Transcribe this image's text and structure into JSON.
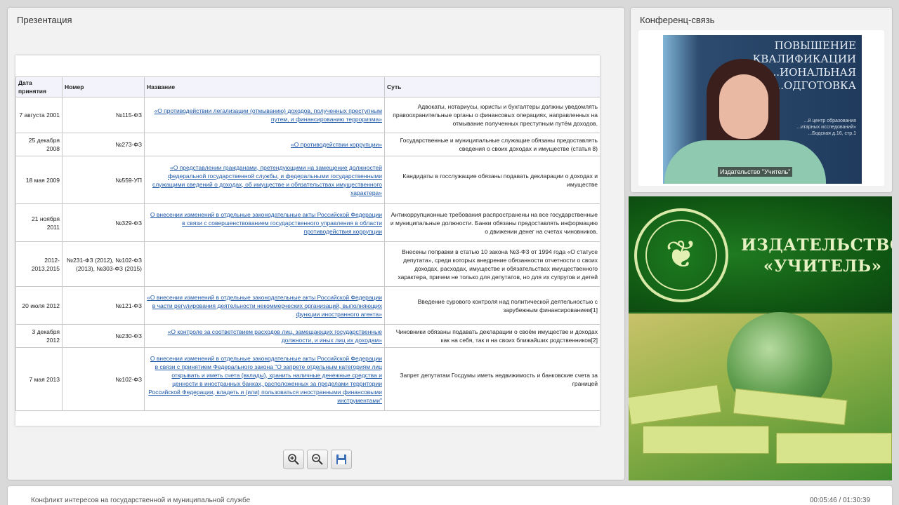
{
  "presentation": {
    "title": "Презентация",
    "table": {
      "headers": [
        "Дата принятия",
        "Номер",
        "Название",
        "Суть"
      ],
      "rows": [
        {
          "date": "7 августа 2001",
          "number": "№115-ФЗ",
          "name": "«О противодействии легализации (отмыванию) доходов, полученных преступным путем, и финансированию терроризма»",
          "essence": "Адвокаты, нотариусы, юристы и бухгалтеры должны уведомлять правоохранительные органы о финансовых операциях, направленных на отмывание полученных преступным путём доходов."
        },
        {
          "date": "25 декабря 2008",
          "number": "№273-ФЗ",
          "name": "«О противодействии коррупции»",
          "essence": "Государственные и муниципальные служащие обязаны предоставлять сведения о своих доходах и имуществе (статья 8)"
        },
        {
          "date": "18 мая 2009",
          "number": "№559-УП",
          "name": "«О представлении гражданами, претендующими на замещение должностей федеральной государственной службы, и федеральными государственными служащими сведений о доходах, об имуществе и обязательствах имущественного характера»",
          "essence": "Кандидаты в госслужащие обязаны подавать декларации о доходах и имуществе"
        },
        {
          "date": "21 ноября 2011",
          "number": "№329-ФЗ",
          "name": "О внесении изменений в отдельные законодательные акты Российской Федерации в связи с совершенствованием государственного управления в области противодействия коррупции",
          "essence": "Антикоррупционные требования распространены на все государственные и муниципальные должности. Банки обязаны предоставлять информацию о движении денег на счетах чиновников."
        },
        {
          "date": "2012-2013,2015",
          "number": "№231-ФЗ (2012), №102-ФЗ (2013), №303-ФЗ (2015)",
          "name": "",
          "essence": "Внесены поправки в статью 10 закона №3-ФЗ от 1994 года «О статусе депутата», среди которых внедрение обязанности отчетности о своих доходах, расходах, имуществе и обязательствах имущественного характера, причем не только для депутатов, но для их супругов и детей"
        },
        {
          "date": "20 июля 2012",
          "number": "№121-ФЗ",
          "name": "«О внесении изменений в отдельные законодательные акты Российской Федерации в части регулирования деятельности некоммерческих организаций, выполняющих функции иностранного агента»",
          "essence": "Введение сурового контроля над политической деятельностью с зарубежным финансированием[1]"
        },
        {
          "date": "3 декабря 2012",
          "number": "№230-ФЗ",
          "name": "«О контроле за соответствием расходов лиц, замещающих государственные должности, и иных лиц их доходам»",
          "essence": "Чиновники обязаны подавать декларации о своём имуществе и доходах как на себя, так и на своих ближайших родственников[2]"
        },
        {
          "date": "7 мая 2013",
          "number": "№102-ФЗ",
          "name": "О внесении изменений в отдельные законодательные акты Российской Федерации в связи с принятием Федерального закона \"О запрете отдельным категориям лиц открывать и иметь счета (вклады), хранить наличные денежные средства и ценности в иностранных банках, расположенных за пределами территории Российской Федерации, владеть и (или) пользоваться иностранными финансовыми инструментами\"",
          "essence": "Запрет депутатам Госдумы иметь недвижимость и банковские счета за границей"
        }
      ]
    }
  },
  "toolbar": {
    "zoom_in_icon": "zoom-in-icon",
    "zoom_out_icon": "zoom-out-icon",
    "save_icon": "save-icon"
  },
  "conference": {
    "title": "Конференц-связь",
    "banner_lines": [
      "ПОВЫШЕНИЕ",
      "КВАЛИФИКАЦИИ",
      "...ИОНАЛЬНАЯ",
      "...ОДГОТОВКА"
    ],
    "banner_small": [
      "...й центр образования",
      "...итарных исследований»",
      "...Бодская д.16, стр.1"
    ],
    "speaker_label": "Издательство \"Учитель\""
  },
  "publisher": {
    "name_line1": "ИЗДАТЕЛЬСТВО",
    "name_line2": "«УЧИТЕЛЬ»",
    "brand_green": "#125c15"
  },
  "footer": {
    "course_title": "Конфликт интересов на государственной и муниципальной службе",
    "time": "00:05:46 / 01:30:39"
  }
}
